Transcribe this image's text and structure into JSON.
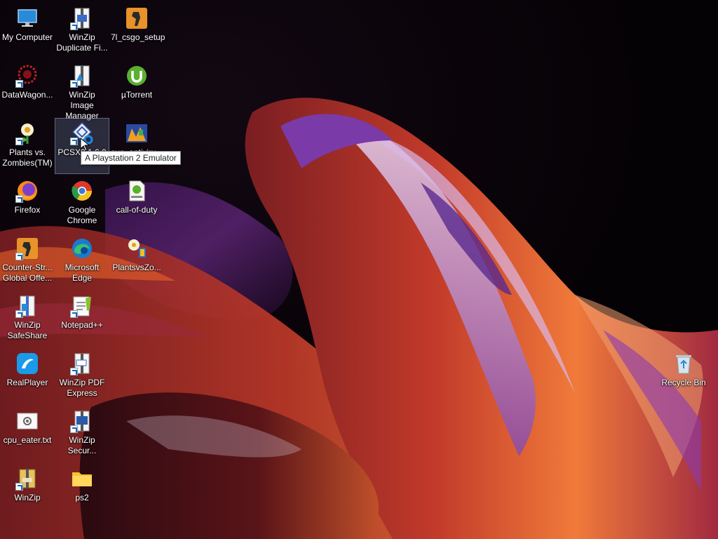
{
  "desktop": {
    "icons": [
      {
        "label": "My Computer",
        "icon": "monitor-icon"
      },
      {
        "label": "WinZip\nDuplicate Fi...",
        "icon": "winzip-icon"
      },
      {
        "label": "7l_csgo_setup",
        "icon": "csgo-icon"
      },
      {
        "label": "DataWagon...",
        "icon": "datawagon-icon"
      },
      {
        "label": "WinZip Image\nManager",
        "icon": "winzip-icon"
      },
      {
        "label": "µTorrent",
        "icon": "utorrent-icon"
      },
      {
        "label": "Plants vs.\nZombies(TM)",
        "icon": "plants-icon"
      },
      {
        "label": "PCSX2 1.6.0",
        "icon": "pcsx2-icon"
      },
      {
        "label": "avg_antiviru...",
        "icon": "avg-icon"
      },
      {
        "label": "Firefox",
        "icon": "firefox-icon"
      },
      {
        "label": "Google\nChrome",
        "icon": "chrome-icon"
      },
      {
        "label": "call-of-duty",
        "icon": "torrent-file-icon"
      },
      {
        "label": "Counter-Str...\nGlobal Offe...",
        "icon": "csgo-icon"
      },
      {
        "label": "Microsoft\nEdge",
        "icon": "edge-icon"
      },
      {
        "label": "PlantsvsZo...",
        "icon": "plants-icon"
      },
      {
        "label": "WinZip\nSafeShare",
        "icon": "winzip-icon"
      },
      {
        "label": "Notepad++",
        "icon": "notepad-icon"
      },
      {
        "label": "RealPlayer",
        "icon": "realplayer-icon"
      },
      {
        "label": "WinZip PDF\nExpress",
        "icon": "winzip-pdf-icon"
      },
      {
        "label": "cpu_eater.txt",
        "icon": "text-file-icon"
      },
      {
        "label": "WinZip\nSecur...",
        "icon": "winzip-icon"
      },
      {
        "label": "WinZip",
        "icon": "winzip-icon"
      },
      {
        "label": "ps2",
        "icon": "folder-icon"
      },
      {
        "label": "Recycle Bin",
        "icon": "recycle-bin-icon"
      }
    ],
    "tooltip": "A Playstation 2 Emulator",
    "selected": "PCSX2 1.6.0"
  },
  "colors": {
    "background": "#060307",
    "accent_orange": "#e8622a",
    "accent_purple": "#6b2fa0"
  }
}
